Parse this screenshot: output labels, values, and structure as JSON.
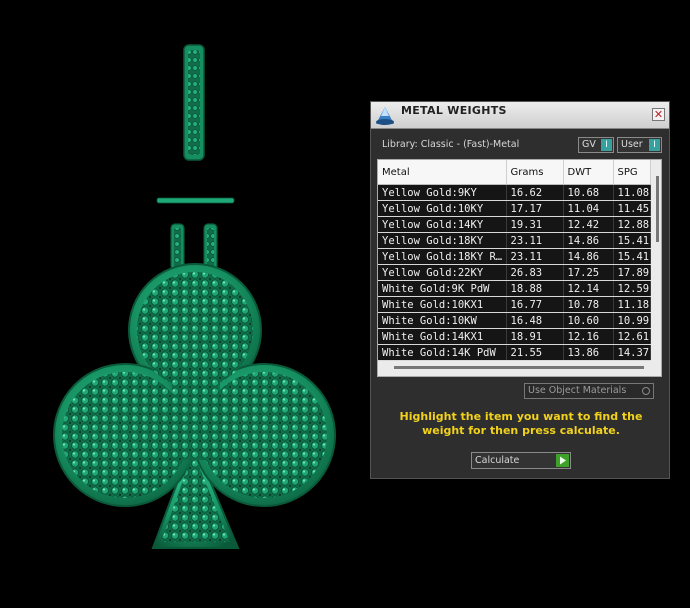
{
  "panel": {
    "title": "METAL WEIGHTS",
    "close_glyph": "✕",
    "library_label": "Library: Classic - (Fast)-Metal",
    "toggles": [
      {
        "label": "GV",
        "knob": "I"
      },
      {
        "label": "User",
        "knob": "I"
      }
    ],
    "table": {
      "columns": [
        "Metal",
        "Grams",
        "DWT",
        "SPG"
      ],
      "rows": [
        [
          "Yellow Gold:9KY",
          "16.62",
          "10.68",
          "11.08"
        ],
        [
          "Yellow Gold:10KY",
          "17.17",
          "11.04",
          "11.45"
        ],
        [
          "Yellow Gold:14KY",
          "19.31",
          "12.42",
          "12.88"
        ],
        [
          "Yellow Gold:18KY",
          "23.11",
          "14.86",
          "15.41"
        ],
        [
          "Yellow Gold:18KY R…",
          "23.11",
          "14.86",
          "15.41"
        ],
        [
          "Yellow Gold:22KY",
          "26.83",
          "17.25",
          "17.89"
        ],
        [
          "White Gold:9K PdW",
          "18.88",
          "12.14",
          "12.59"
        ],
        [
          "White Gold:10KX1",
          "16.77",
          "10.78",
          "11.18"
        ],
        [
          "White Gold:10KW",
          "16.48",
          "10.60",
          "10.99"
        ],
        [
          "White Gold:14KX1",
          "18.91",
          "12.16",
          "12.61"
        ],
        [
          "White Gold:14K PdW",
          "21.55",
          "13.86",
          "14.37"
        ]
      ]
    },
    "use_object_materials": "Use Object Materials",
    "instructions": "Highlight the item you want to find the weight for then press calculate.",
    "calculate_label": "Calculate"
  },
  "icons": {
    "app": "rhino-logo-icon",
    "close": "close-icon",
    "calculate": "play-icon"
  },
  "colors": {
    "viewport_bg": "#000000",
    "pendant_green": "#1fa878",
    "panel_bg": "#2e2e2e",
    "instruction_text": "#f2d21c",
    "toggle_accent": "#39a0a0",
    "calculate_accent": "#3ea12a"
  }
}
